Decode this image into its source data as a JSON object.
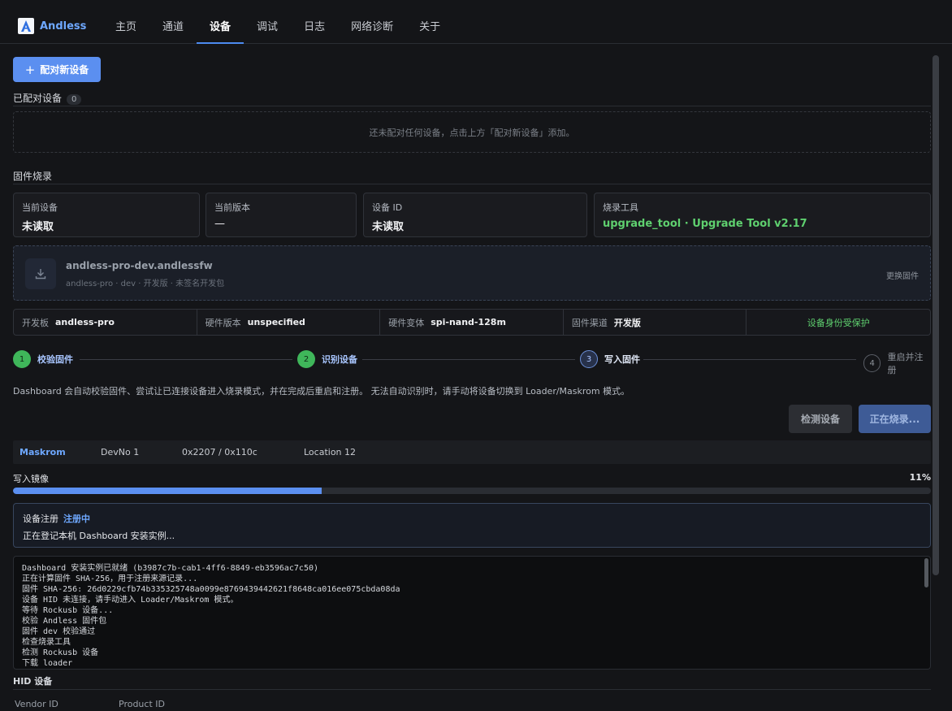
{
  "app": {
    "name": "Andless"
  },
  "nav": {
    "items": [
      {
        "label": "主页",
        "active": false
      },
      {
        "label": "通道",
        "active": false
      },
      {
        "label": "设备",
        "active": true
      },
      {
        "label": "调试",
        "active": false
      },
      {
        "label": "日志",
        "active": false
      },
      {
        "label": "网络诊断",
        "active": false
      },
      {
        "label": "关于",
        "active": false
      }
    ]
  },
  "pair": {
    "button_label": "配对新设备",
    "section_title": "已配对设备",
    "count": "0",
    "empty_text": "还未配对任何设备，点击上方「配对新设备」添加。"
  },
  "firmware": {
    "section_title": "固件烧录",
    "cards": [
      {
        "label": "当前设备",
        "value": "未读取"
      },
      {
        "label": "当前版本",
        "value": "—"
      },
      {
        "label": "设备 ID",
        "value": "未读取"
      },
      {
        "label": "烧录工具",
        "value": "upgrade_tool · Upgrade Tool v2.17"
      }
    ],
    "file_name": "andless-pro-dev.andlessfw",
    "file_meta": "andless-pro · dev · 开发版 · 未签名开发包",
    "change_label": "更换固件",
    "meta": [
      {
        "key": "开发板",
        "value": "andless-pro"
      },
      {
        "key": "硬件版本",
        "value": "unspecified"
      },
      {
        "key": "硬件变体",
        "value": "spi-nand-128m"
      },
      {
        "key": "固件渠道",
        "value": "开发版"
      }
    ],
    "identity_status": "设备身份受保护",
    "steps": [
      {
        "num": "1",
        "label": "校验固件",
        "state": "done"
      },
      {
        "num": "2",
        "label": "识别设备",
        "state": "done"
      },
      {
        "num": "3",
        "label": "写入固件",
        "state": "current"
      },
      {
        "num": "4",
        "label": "重启并注册",
        "state": "todo"
      }
    ],
    "description": "Dashboard 会自动校验固件、尝试让已连接设备进入烧录模式，并在完成后重启和注册。 无法自动识别时，请手动将设备切换到 Loader/Maskrom 模式。",
    "detect_button": "检测设备",
    "flash_button": "正在烧录...",
    "device_row": {
      "mode": "Maskrom",
      "devno": "DevNo 1",
      "ids": "0x2207 / 0x110c",
      "location": "Location 12"
    },
    "progress": {
      "label": "写入镜像",
      "percent_text": "11%",
      "value": 0.336
    },
    "registration": {
      "title": "设备注册",
      "status": "注册中",
      "message": "正在登记本机 Dashboard 安装实例..."
    },
    "log_lines": [
      "Dashboard 安装实例已就绪 (b3987c7b-cab1-4ff6-8849-eb3596ac7c50)",
      "正在计算固件 SHA-256，用于注册来源记录...",
      "固件 SHA-256: 26d0229cfb74b335325748a0099e8769439442621f8648ca016ee075cbda08da",
      "设备 HID 未连接，请手动进入 Loader/Maskrom 模式。",
      "等待 Rockusb 设备...",
      "校验 Andless 固件包",
      "固件 dev 校验通过",
      "检查烧录工具",
      "检测 Rockusb 设备",
      "下载 loader"
    ]
  },
  "hid": {
    "section_title": "HID 设备",
    "columns": [
      "Vendor ID",
      "Product ID"
    ]
  },
  "colors": {
    "accent": "#5b8ff0",
    "success": "#5fd06f",
    "background": "#141518"
  }
}
